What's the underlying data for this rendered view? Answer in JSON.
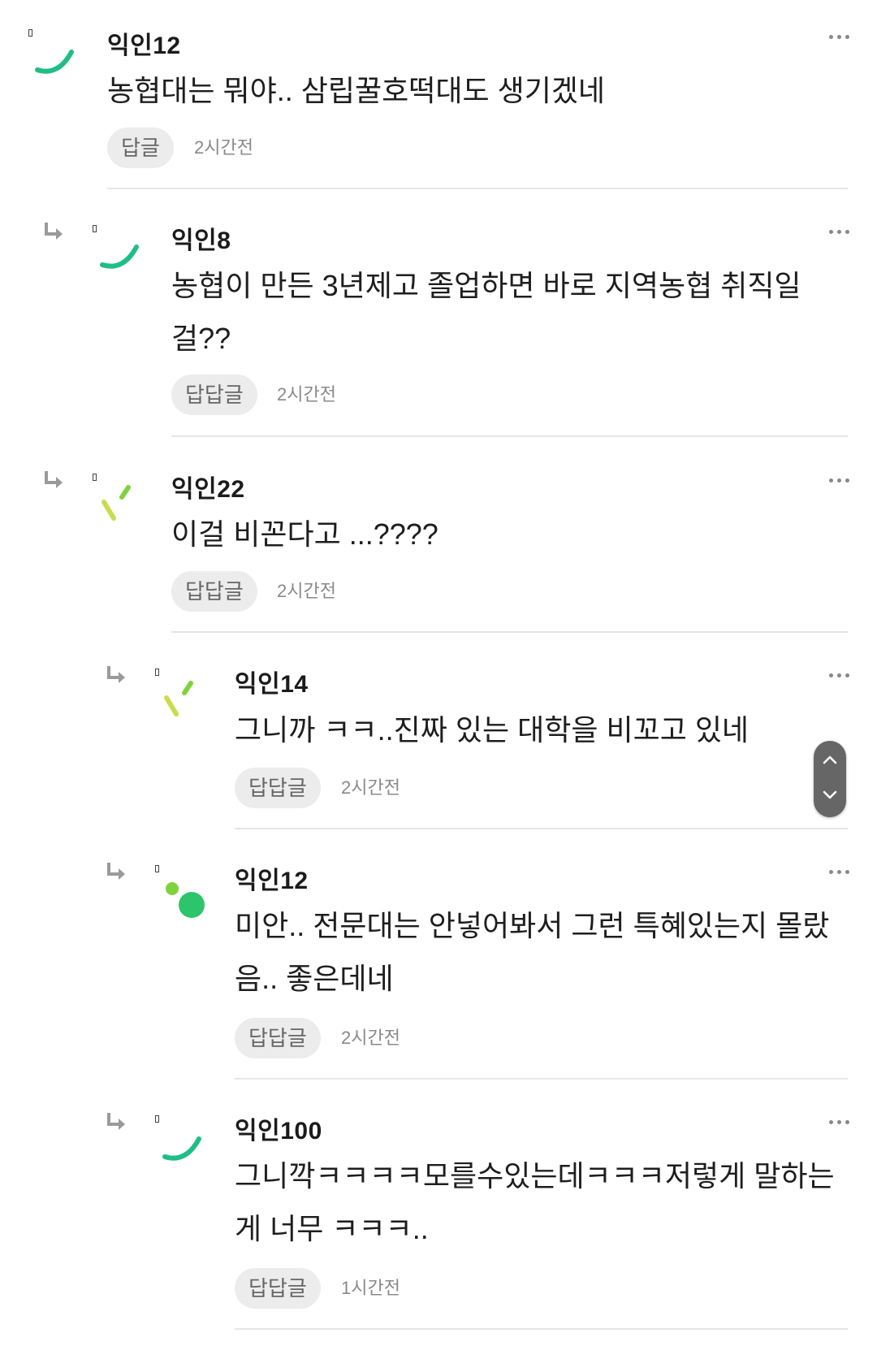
{
  "comments": [
    {
      "nick": "익인12",
      "text": "농협대는 뭐야.. 삼립꿀호떡대도 생기겠네",
      "reply_label": "답글",
      "time": "2시간전",
      "avatar": "green-arc"
    },
    {
      "nick": "익인8",
      "text": "농협이 만든 3년제고 졸업하면 바로 지역농협 취직일 걸??",
      "reply_label": "답답글",
      "time": "2시간전",
      "avatar": "green-arc"
    },
    {
      "nick": "익인22",
      "text": "이걸 비꼰다고 ...????",
      "reply_label": "답답글",
      "time": "2시간전",
      "avatar": "yellow-ticks"
    },
    {
      "nick": "익인14",
      "text": "그니까 ㅋㅋ..진짜 있는 대학을 비꼬고 있네",
      "reply_label": "답답글",
      "time": "2시간전",
      "avatar": "yellow-ticks"
    },
    {
      "nick": "익인12",
      "text": "미안.. 전문대는 안넣어봐서 그런 특혜있는지 몰랐음.. 좋은데네",
      "reply_label": "답답글",
      "time": "2시간전",
      "avatar": "green-dots"
    },
    {
      "nick": "익인100",
      "text": "그니깍ㅋㅋㅋㅋ모를수있는데ㅋㅋㅋ저렇게 말하는게 너무 ㅋㅋㅋ..",
      "reply_label": "답답글",
      "time": "1시간전",
      "avatar": "green-arc"
    }
  ],
  "colors": {
    "accent_green": "#1fbe85",
    "accent_lime": "#7fd23b",
    "accent_yellow": "#c9dc4d"
  },
  "icons": {
    "reply": "reply-arrow-icon",
    "more": "more-dots-icon",
    "scroll_up": "chevron-up-icon",
    "scroll_down": "chevron-down-icon"
  }
}
